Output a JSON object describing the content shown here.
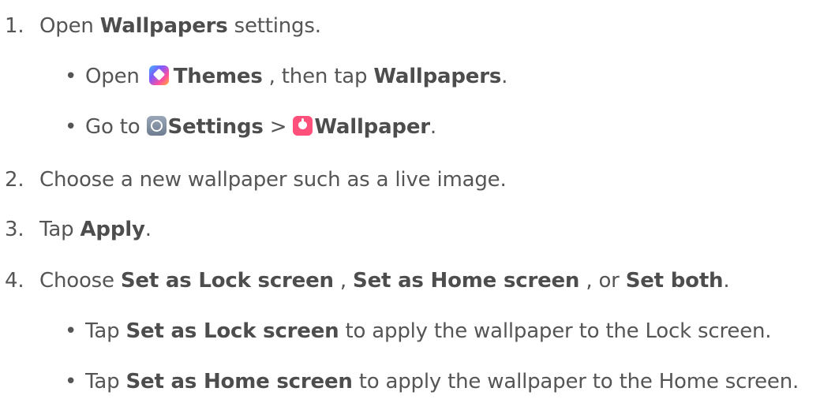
{
  "steps": [
    {
      "number": "1.",
      "segments": {
        "a": "Open ",
        "b": "Wallpapers",
        "c": " settings."
      },
      "sub": [
        {
          "bullet": "•",
          "segments": {
            "a": "Open ",
            "icon": "themes-icon",
            "b": "Themes",
            "c": " , then tap ",
            "d": "Wallpapers",
            "e": "."
          }
        },
        {
          "bullet": "•",
          "segments": {
            "a": "Go to ",
            "icon1": "settings-icon",
            "b": "Settings",
            "c": " > ",
            "icon2": "wallpaper-icon",
            "d": "Wallpaper",
            "e": "."
          }
        }
      ]
    },
    {
      "number": "2.",
      "segments": {
        "a": "Choose a new wallpaper such as a live image."
      }
    },
    {
      "number": "3.",
      "segments": {
        "a": "Tap ",
        "b": "Apply",
        "c": "."
      }
    },
    {
      "number": "4.",
      "segments": {
        "a": "Choose ",
        "b": "Set as Lock screen",
        "c": " , ",
        "d": "Set as Home screen",
        "e": " , or ",
        "f": "Set both",
        "g": "."
      },
      "sub": [
        {
          "bullet": "•",
          "segments": {
            "a": "Tap ",
            "b": "Set as Lock screen",
            "c": " to apply the wallpaper to the Lock screen."
          }
        },
        {
          "bullet": "•",
          "segments": {
            "a": "Tap ",
            "b": "Set as Home screen",
            "c": " to apply the wallpaper to the Home screen."
          }
        }
      ]
    }
  ],
  "colors": {
    "text": "#555555",
    "bold_text": "#4d4d4d",
    "themes_icon": "#7a5cff",
    "settings_icon": "#7f8c9e",
    "wallpaper_icon": "#ff4f7b"
  }
}
